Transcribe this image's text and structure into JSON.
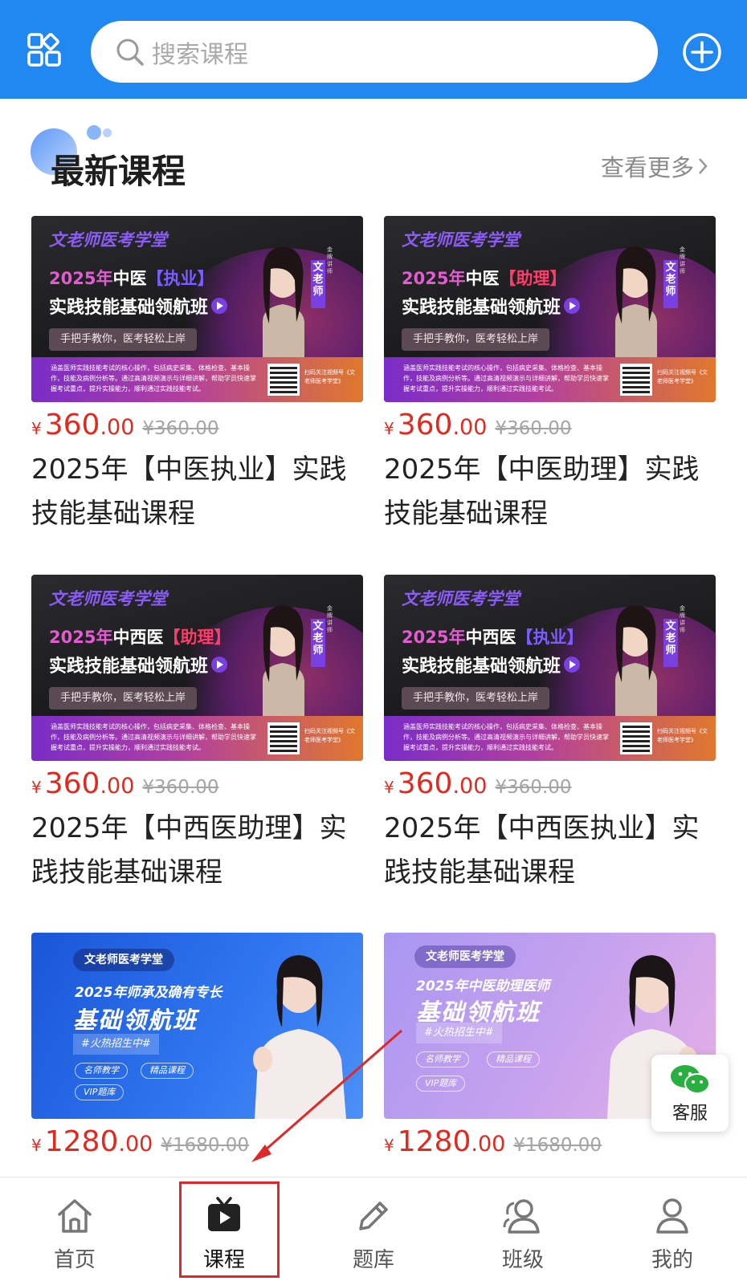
{
  "header": {
    "search_placeholder": "搜索课程",
    "menu_icon": "grid-apps-icon",
    "add_icon": "plus-circle-icon",
    "bg_color": "#2088f0"
  },
  "section": {
    "title": "最新课程",
    "more_label": "查看更多"
  },
  "courses": [
    {
      "banner_brand": "文老师医考学堂",
      "banner_year": "2025年",
      "banner_subject": "中医",
      "banner_tag": "【执业】",
      "banner_main": "实践技能基础领航班",
      "banner_slogan": "手把手教你，医考轻松上岸",
      "banner_teacher": "文老师",
      "banner_gold": "金牌讲师",
      "banner_desc": "涵盖医师实践技能考试的核心操作，包括病史采集、体格检查、基本操作，技能及病例分析等。通过高清视频演示与详细讲解，帮助学员快速掌握考试重点，提升实操能力，顺利通过实践技能考试。",
      "banner_qr_text": "扫码关注视频号《文老师医考学堂》",
      "price_int": "360",
      "price_dec": ".00",
      "price_old": "¥360.00",
      "title": "2025年【中医执业】实践技能基础课程"
    },
    {
      "banner_brand": "文老师医考学堂",
      "banner_year": "2025年",
      "banner_subject": "中医",
      "banner_tag": "【助理】",
      "banner_main": "实践技能基础领航班",
      "banner_slogan": "手把手教你，医考轻松上岸",
      "banner_teacher": "文老师",
      "banner_gold": "金牌讲师",
      "banner_desc": "涵盖医师实践技能考试的核心操作，包括病史采集、体格检查、基本操作，技能及病例分析等。通过高清视频演示与详细讲解，帮助学员快速掌握考试重点，提升实操能力，顺利通过实践技能考试。",
      "banner_qr_text": "扫码关注视频号《文老师医考学堂》",
      "price_int": "360",
      "price_dec": ".00",
      "price_old": "¥360.00",
      "title": "2025年【中医助理】实践技能基础课程"
    },
    {
      "banner_brand": "文老师医考学堂",
      "banner_year": "2025年",
      "banner_subject": "中西医",
      "banner_tag": "【助理】",
      "banner_main": "实践技能基础领航班",
      "banner_slogan": "手把手教你，医考轻松上岸",
      "banner_teacher": "文老师",
      "banner_gold": "金牌讲师",
      "banner_desc": "涵盖医师实践技能考试的核心操作，包括病史采集、体格检查、基本操作，技能及病例分析等。通过高清视频演示与详细讲解，帮助学员快速掌握考试重点，提升实操能力，顺利通过实践技能考试。",
      "banner_qr_text": "扫码关注视频号《文老师医考学堂》",
      "price_int": "360",
      "price_dec": ".00",
      "price_old": "¥360.00",
      "title": "2025年【中西医助理】实践技能基础课程"
    },
    {
      "banner_brand": "文老师医考学堂",
      "banner_year": "2025年",
      "banner_subject": "中西医",
      "banner_tag": "【执业】",
      "banner_main": "实践技能基础领航班",
      "banner_slogan": "手把手教你，医考轻松上岸",
      "banner_teacher": "文老师",
      "banner_gold": "金牌讲师",
      "banner_desc": "涵盖医师实践技能考试的核心操作，包括病史采集、体格检查、基本操作，技能及病例分析等。通过高清视频演示与详细讲解，帮助学员快速掌握考试重点，提升实操能力，顺利通过实践技能考试。",
      "banner_qr_text": "扫码关注视频号《文老师医考学堂》",
      "price_int": "360",
      "price_dec": ".00",
      "price_old": "¥360.00",
      "title": "2025年【中西医执业】实践技能基础课程"
    },
    {
      "banner_brand": "文老师医考学堂",
      "banner_line1": "2025年师承及确有专长",
      "banner_line2": "基础领航班",
      "banner_hot": "#火热招生中#",
      "banner_chips": [
        "名师教学",
        "精品课程",
        "VIP题库"
      ],
      "price_int": "1280",
      "price_dec": ".00",
      "price_old": "¥1680.00"
    },
    {
      "banner_brand": "文老师医考学堂",
      "banner_line1": "2025年中医助理医师",
      "banner_line2": "基础领航班",
      "banner_hot": "#火热招生中#",
      "banner_chips": [
        "名师教学",
        "精品课程",
        "VIP题库"
      ],
      "price_int": "1280",
      "price_dec": ".00",
      "price_old": "¥1680.00"
    }
  ],
  "currency": "¥",
  "service": {
    "label": "客服",
    "icon": "wechat-icon"
  },
  "tabbar": {
    "items": [
      {
        "label": "首页",
        "icon": "home-icon"
      },
      {
        "label": "课程",
        "icon": "video-play-icon",
        "active": true
      },
      {
        "label": "题库",
        "icon": "pencil-icon"
      },
      {
        "label": "班级",
        "icon": "group-icon"
      },
      {
        "label": "我的",
        "icon": "user-icon"
      }
    ]
  },
  "colors": {
    "price": "#e12a1f",
    "annotation": "#e0282a"
  }
}
